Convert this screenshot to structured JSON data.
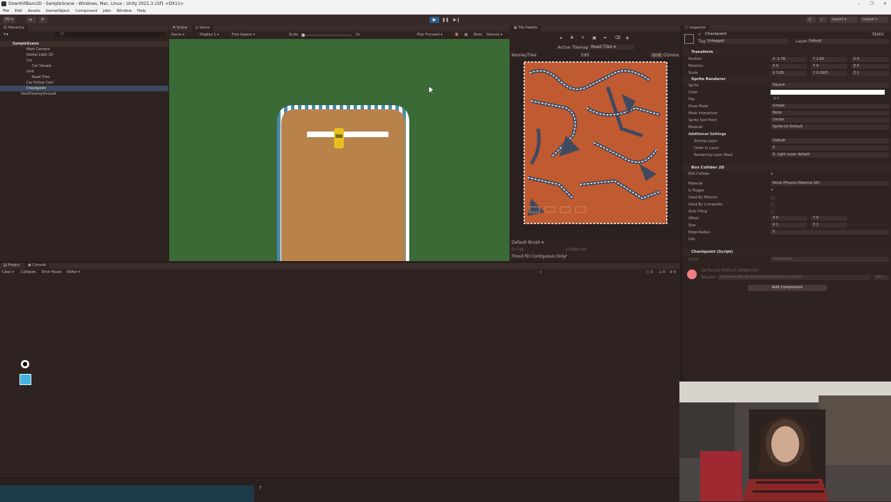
{
  "window": {
    "title": "DownhillBam2D - SampleScene - Windows, Mac, Linux - Unity 2021.3.15f1 <DX11>",
    "controls": [
      "–",
      "❐",
      "✕"
    ]
  },
  "menu": [
    "File",
    "Edit",
    "Assets",
    "GameObject",
    "Component",
    "Jobs",
    "Window",
    "Help"
  ],
  "toolbar": {
    "account": "HD",
    "layers": "Layers",
    "layout": "Layout"
  },
  "hierarchy": {
    "tab": "Hierarchy",
    "search_placeholder": "All",
    "items": [
      {
        "label": "SampleScene",
        "indent": 0
      },
      {
        "label": "Main Camera",
        "indent": 2
      },
      {
        "label": "Global Light 2D",
        "indent": 2
      },
      {
        "label": "Car",
        "indent": 2
      },
      {
        "label": "Car Visuals",
        "indent": 3
      },
      {
        "label": "Grid",
        "indent": 2
      },
      {
        "label": "Road Tiles",
        "indent": 3
      },
      {
        "label": "Car Follow Cam",
        "indent": 2
      },
      {
        "label": "Checkpoint",
        "indent": 2
      },
      {
        "label": "DontDestroyOnLoad",
        "indent": 0
      }
    ]
  },
  "scene": {
    "tabs": [
      "Scene",
      "Game"
    ],
    "game_label": "Game",
    "display": "Display 1",
    "aspect": "Free Aspect",
    "scale_label": "Scale",
    "scale_value": "1x",
    "play_focused": "Play Focused",
    "stats": "Stats",
    "gizmos": "Gizmos"
  },
  "tile_palette": {
    "tab": "Tile Palette",
    "active_tilemap_label": "Active Tilemap",
    "active_tilemap_value": "Road Tiles",
    "palette_name": "KenneyTiles",
    "edit": "Edit",
    "grid": "Grid",
    "gizmos": "Gizmos",
    "brush": "Default Brush",
    "script_label": "Script",
    "script_value": "GridBrush",
    "flood_fill": "Flood Fill Contiguous Only"
  },
  "inspector": {
    "tab": "Inspector",
    "object_name": "Checkpoint",
    "static": "Static",
    "tag_label": "Tag",
    "tag_value": "Untagged",
    "layer_label": "Layer",
    "layer_value": "Default",
    "transform": {
      "title": "Transform",
      "position_label": "Position",
      "rotation_label": "Rotation",
      "scale_label": "Scale",
      "position": [
        "-1.79",
        "2.66",
        "0"
      ],
      "rotation": [
        "0",
        "0",
        "0"
      ],
      "scale": [
        "3.85",
        "0.2625",
        "1"
      ]
    },
    "sprite_renderer": {
      "title": "Sprite Renderer",
      "sprite_label": "Sprite",
      "sprite_value": "Square",
      "color_label": "Color",
      "flip_label": "Flip",
      "draw_mode_label": "Draw Mode",
      "draw_mode_value": "Simple",
      "mask_label": "Mask Interaction",
      "mask_value": "None",
      "sort_point_label": "Sprite Sort Point",
      "sort_point_value": "Center",
      "material_label": "Material",
      "material_value": "Sprite-Lit-Default",
      "additional": "Additional Settings",
      "sorting_layer_label": "Sorting Layer",
      "sorting_layer_value": "Default",
      "order_label": "Order in Layer",
      "order_value": "0",
      "rlm_label": "Rendering Layer Mask",
      "rlm_value": "0: Light Layer default"
    },
    "box_collider": {
      "title": "Box Collider 2D",
      "edit_collider": "Edit Collider",
      "material_label": "Material",
      "material_value": "None (Physics Material 2D)",
      "is_trigger": "Is Trigger",
      "used_by_effector": "Used By Effector",
      "used_by_composite": "Used By Composite",
      "auto_tiling": "Auto Tiling",
      "offset_label": "Offset",
      "offset": [
        "0",
        "0"
      ],
      "size_label": "Size",
      "size": [
        "1",
        "1"
      ],
      "edge_label": "Edge Radius",
      "edge_value": "0",
      "info": "Info"
    },
    "checkpoint_script": {
      "title": "Checkpoint (Script)",
      "script_label": "Script",
      "script_value": "Checkpoint"
    },
    "material_preview": {
      "name": "Sprite-Lit-Default (Material)",
      "shader_label": "Shader",
      "shader_value": "Universal Render Pipeline/2D/Sprite-Lit-Default",
      "edit": "Edit..."
    },
    "add_component": "Add Component"
  },
  "console": {
    "tabs": [
      "Project",
      "Console"
    ],
    "clear": "Clear",
    "collapse": "Collapse",
    "error_pause": "Error Pause",
    "editor": "Editor",
    "counts": [
      "0",
      "0",
      "0"
    ]
  },
  "colors": {
    "game_bg": "#3a6a35",
    "road": "#b8824a",
    "stripe": "#4a8ab0",
    "tiles_bg": "#c05a30",
    "checkpoint": "#ffffff",
    "car": "#e8c020"
  }
}
